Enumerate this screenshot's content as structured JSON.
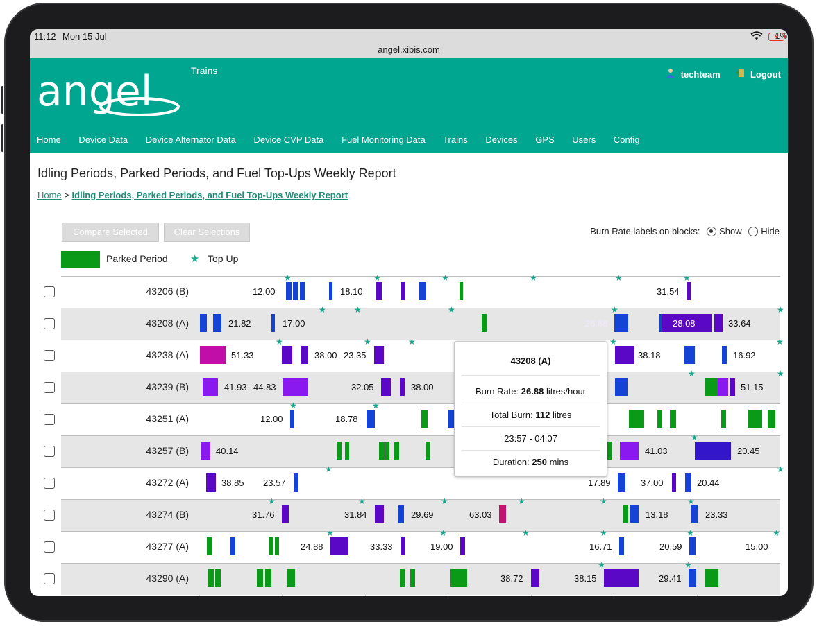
{
  "status": {
    "time": "11:12",
    "date": "Mon 15 Jul",
    "battery": "1%"
  },
  "browser": {
    "url": "angel.xibis.com"
  },
  "brand": {
    "logo_text": "angel",
    "logo_sub": "Trains"
  },
  "user": {
    "name": "techteam",
    "logout_label": "Logout"
  },
  "nav": [
    "Home",
    "Device Data",
    "Device Alternator Data",
    "Device CVP Data",
    "Fuel Monitoring Data",
    "Trains",
    "Devices",
    "GPS",
    "Users",
    "Config"
  ],
  "page": {
    "title": "Idling Periods, Parked Periods, and Fuel Top-Ups Weekly Report",
    "breadcrumb_home": "Home",
    "breadcrumb_sep": ">",
    "breadcrumb_current": "Idling Periods, Parked Periods, and Fuel Top-Ups Weekly Report"
  },
  "controls": {
    "compare_label": "Compare Selected",
    "clear_label": "Clear Selections",
    "burn_rate_label": "Burn Rate labels on blocks:",
    "show_label": "Show",
    "hide_label": "Hide",
    "show_selected": true
  },
  "legend": {
    "parked_label": "Parked Period",
    "topup_label": "Top Up",
    "parked_color": "#0a9a18",
    "topup_color": "#1aa58b"
  },
  "rows": [
    {
      "id": "43206 (B)",
      "values": [
        "12.00",
        "18.10",
        "31.54"
      ]
    },
    {
      "id": "43208 (A)",
      "values": [
        "21.82",
        "17.00",
        "26.88",
        "28.08",
        "33.64"
      ]
    },
    {
      "id": "43238 (A)",
      "values": [
        "51.33",
        "38.00",
        "23.35",
        "38.18",
        "16.92"
      ]
    },
    {
      "id": "43239 (B)",
      "values": [
        "41.93",
        "44.83",
        "32.05",
        "38.00",
        "51.15"
      ]
    },
    {
      "id": "43251 (A)",
      "values": [
        "12.00",
        "18.78"
      ]
    },
    {
      "id": "43257 (B)",
      "values": [
        "40.14",
        "41.03",
        "20.45"
      ]
    },
    {
      "id": "43272 (A)",
      "values": [
        "38.85",
        "23.57",
        "17.89",
        "37.00",
        "20.44"
      ]
    },
    {
      "id": "43274 (B)",
      "values": [
        "31.76",
        "31.84",
        "29.69",
        "63.03",
        "13.18",
        "23.33"
      ]
    },
    {
      "id": "43277 (A)",
      "values": [
        "24.88",
        "33.33",
        "19.00",
        "16.71",
        "20.59",
        "15.00"
      ]
    },
    {
      "id": "43290 (A)",
      "values": [
        "38.72",
        "38.15",
        "29.41"
      ]
    }
  ],
  "tooltip": {
    "title": "43208 (A)",
    "burn_rate_label": "Burn Rate:",
    "burn_rate_value": "26.88",
    "burn_rate_unit": "litres/hour",
    "total_burn_label": "Total Burn:",
    "total_burn_value": "112",
    "total_burn_unit": "litres",
    "time_range": "23:57 - 04:07",
    "duration_label": "Duration:",
    "duration_value": "250",
    "duration_unit": "mins"
  }
}
